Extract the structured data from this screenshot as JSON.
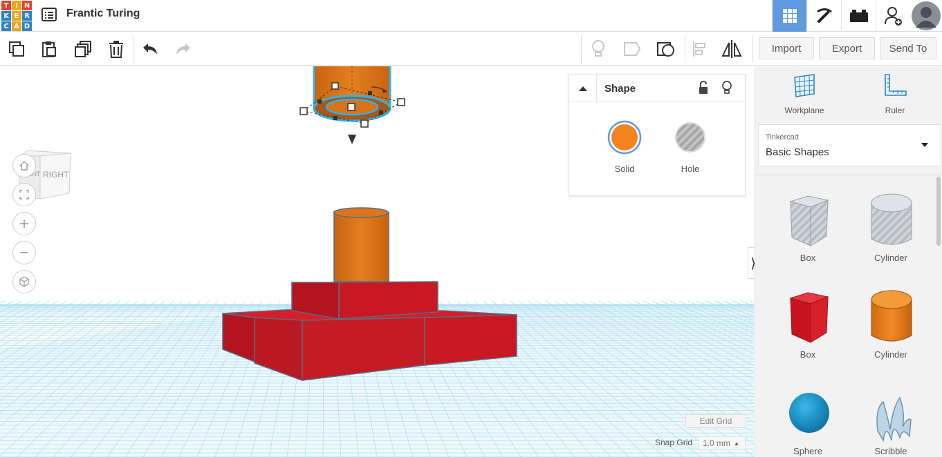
{
  "app": {
    "logo_letters": [
      "T",
      "I",
      "N",
      "K",
      "E",
      "R",
      "C",
      "A",
      "D"
    ],
    "logo_colors": [
      "#e5422b",
      "#f0a41e",
      "#e5422b",
      "#2b85c6",
      "#f0a41e",
      "#2b85c6",
      "#2b85c6",
      "#f0a41e",
      "#2b85c6"
    ],
    "project_title": "Frantic Turing"
  },
  "top_icons": [
    "grid-view-icon",
    "pickaxe-icon",
    "bricks-icon",
    "add-user-icon",
    "user-avatar"
  ],
  "toolbar": {
    "left_tools": [
      "copy-icon",
      "paste-icon",
      "duplicate-icon",
      "delete-icon",
      "undo-icon",
      "redo-icon"
    ],
    "right_tools": [
      "note-bulb-icon",
      "note-shape-icon",
      "workplane-view-icon",
      "align-icon",
      "mirror-icon"
    ],
    "import_label": "Import",
    "export_label": "Export",
    "send_to_label": "Send To"
  },
  "viewcube": {
    "front_label": "FRONT",
    "right_label": "RIGHT"
  },
  "nav_controls": [
    "home-icon",
    "fit-view-icon",
    "zoom-in-icon",
    "zoom-out-icon",
    "perspective-icon"
  ],
  "shape_panel": {
    "title": "Shape",
    "solid_label": "Solid",
    "hole_label": "Hole",
    "solid_color": "#f5831f"
  },
  "grid": {
    "edit_grid_label": "Edit Grid",
    "snap_grid_label": "Snap Grid",
    "snap_grid_value": "1.0 mm"
  },
  "sidebar": {
    "workplane_label": "Workplane",
    "ruler_label": "Ruler",
    "library_category": "Tinkercad",
    "library_name": "Basic Shapes",
    "shapes": [
      {
        "label": "Box",
        "icon": "box-hole-icon"
      },
      {
        "label": "Cylinder",
        "icon": "cylinder-hole-icon"
      },
      {
        "label": "Box",
        "icon": "box-red-icon"
      },
      {
        "label": "Cylinder",
        "icon": "cylinder-orange-icon"
      },
      {
        "label": "Sphere",
        "icon": "sphere-blue-icon"
      },
      {
        "label": "Scribble",
        "icon": "scribble-icon"
      }
    ]
  },
  "colors": {
    "accent": "#5f9ae0",
    "red_shape": "#c81923",
    "orange_shape": "#d8731a",
    "grid_line": "#9fd4ea",
    "selection": "#2fb3e6"
  }
}
